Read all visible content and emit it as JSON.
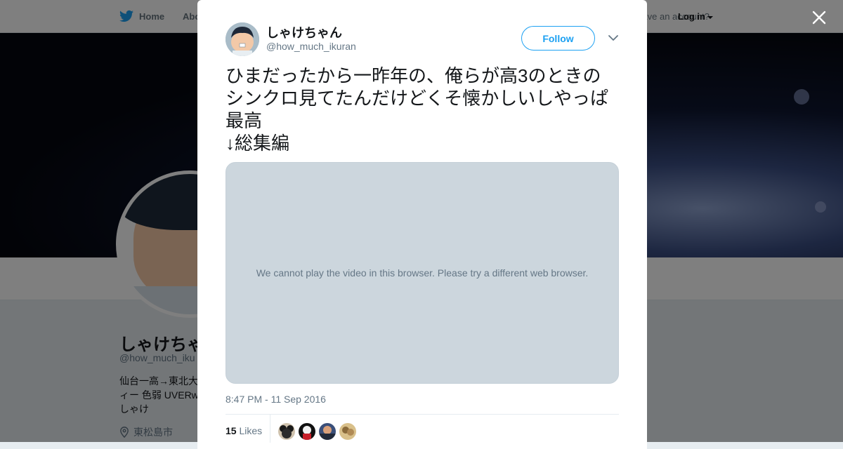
{
  "nav": {
    "home_label": "Home",
    "about_label": "Abo",
    "account_prompt": "Have an account?",
    "login_label": "Log in"
  },
  "profile": {
    "name": "しゃけちゃ",
    "handle": "@how_much_iku",
    "bio": "仙台一高→東北大\nィー 色弱 UVERw\nしゃけ",
    "location": "東松島市"
  },
  "tweet": {
    "author_name": "しゃけちゃん",
    "author_handle": "@how_much_ikuran",
    "follow_label": "Follow",
    "text": "ひまだったから一昨年の、俺らが高3のときのシンクロ見てたんだけどくそ懐かしいしやっぱ最高\n↓総集編",
    "video_message": "We cannot play the video in this browser. Please try a different web browser.",
    "timestamp": "8:47 PM - 11 Sep 2016",
    "likes_count": "15",
    "likes_label": "Likes"
  },
  "icons": [
    "twitter-bird-icon",
    "close-icon",
    "chevron-down-icon",
    "location-pin-icon"
  ],
  "colors": {
    "accent": "#1da1f2",
    "text": "#14171a",
    "muted": "#657786",
    "video_bg": "#ccd6dd"
  }
}
